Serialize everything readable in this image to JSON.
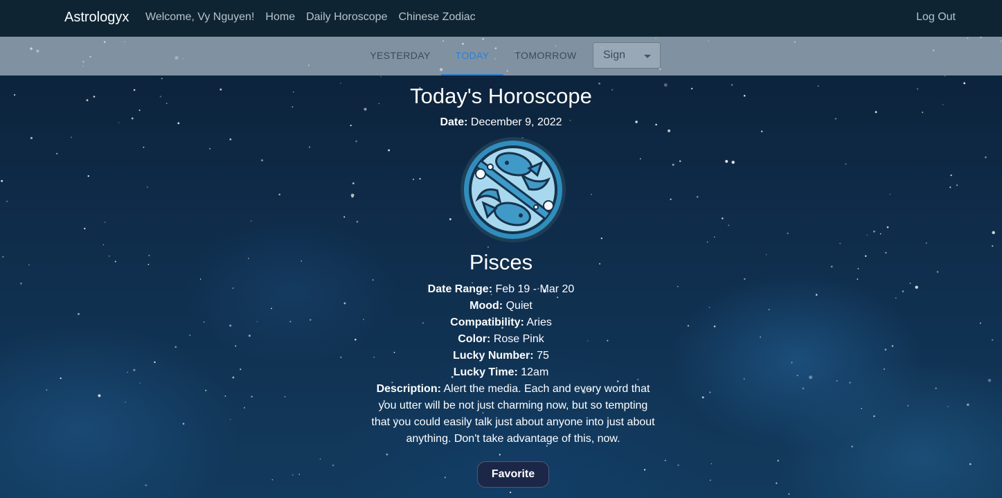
{
  "navbar": {
    "brand": "Astrologyx",
    "links": [
      "Welcome, Vy Nguyen!",
      "Home",
      "Daily Horoscope",
      "Chinese Zodiac"
    ],
    "logout": "Log Out"
  },
  "day_tabs": {
    "yesterday": "YESTERDAY",
    "today": "TODAY",
    "tomorrow": "TOMORROW",
    "active": "TODAY",
    "sign_select": "Sign"
  },
  "horoscope": {
    "title": "Today's Horoscope",
    "date_label": "Date:",
    "date_value": "December 9, 2022",
    "sign": "Pisces",
    "sign_icon": "pisces-zodiac-icon",
    "details": [
      {
        "label": "Date Range:",
        "value": "Feb 19 - Mar 20"
      },
      {
        "label": "Mood:",
        "value": "Quiet"
      },
      {
        "label": "Compatibility:",
        "value": "Aries"
      },
      {
        "label": "Color:",
        "value": "Rose Pink"
      },
      {
        "label": "Lucky Number:",
        "value": "75"
      },
      {
        "label": "Lucky Time:",
        "value": "12am"
      }
    ],
    "description_label": "Description:",
    "description": "Alert the media. Each and every word that you utter will be not just charming now, but so tempting that you could easily talk just about anyone into just about anything. Don't take advantage of this, now."
  },
  "favorite_button": "Favorite",
  "colors": {
    "navbar": "#0e2433",
    "accent": "#2a7fd4",
    "button": "#1c2747"
  }
}
